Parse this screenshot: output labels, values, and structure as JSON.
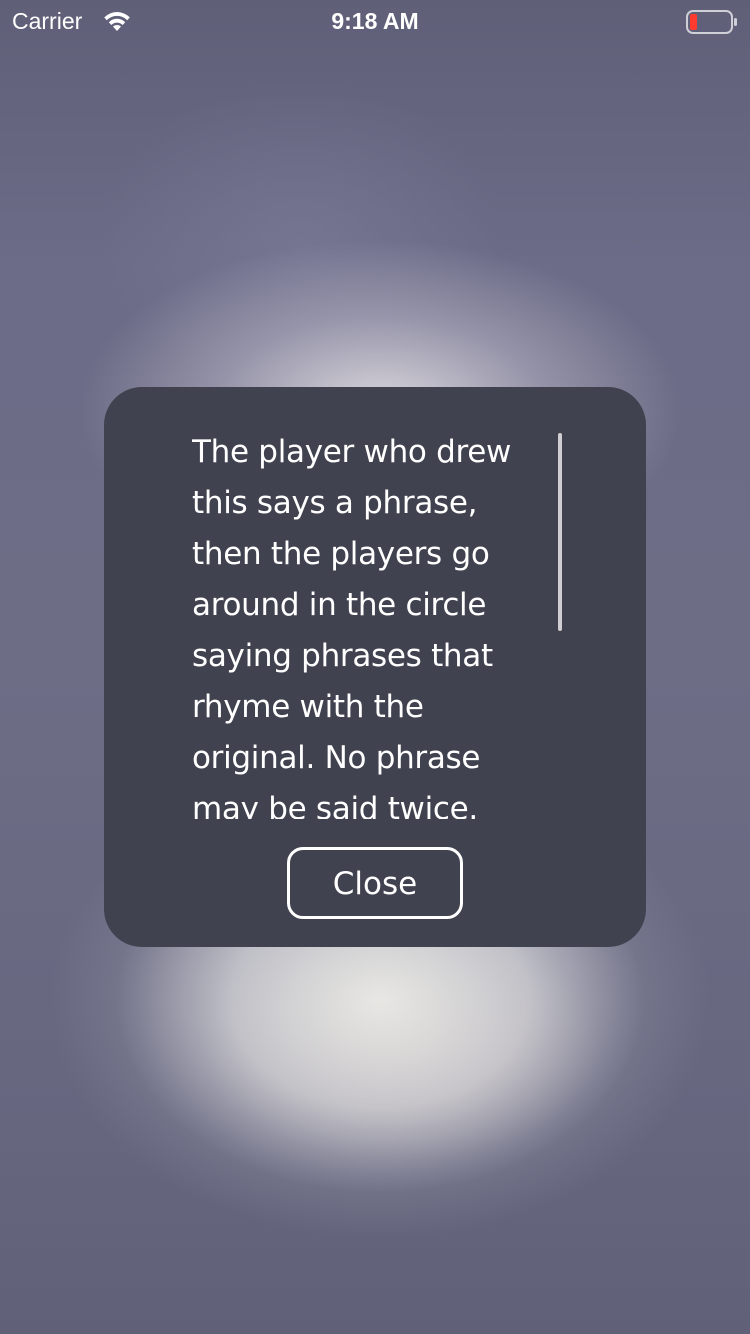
{
  "status_bar": {
    "carrier": "Carrier",
    "time": "9:18 AM",
    "wifi_icon": "wifi-icon",
    "battery_icon": "battery-icon",
    "battery_color": "#ff3b30"
  },
  "modal": {
    "body_text": "The player who drew this says a phrase, then the players go around in the circle saying phrases that rhyme with the original. No phrase may be said twice.",
    "close_label": "Close",
    "background_color": "#41424f"
  }
}
